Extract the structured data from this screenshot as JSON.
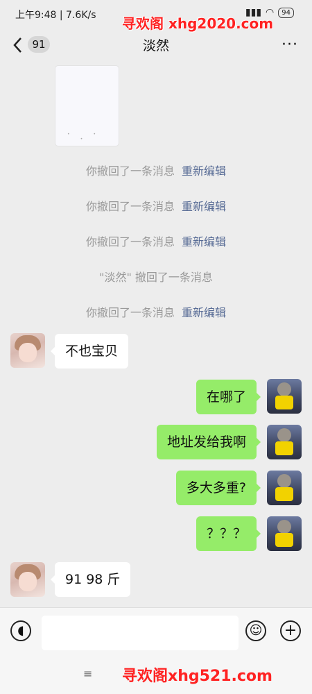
{
  "status_bar": {
    "time": "上午9:48 | 7.6K/s",
    "watermark": "寻欢阁 xhg2020.com",
    "battery": "94"
  },
  "header": {
    "back_count": "91",
    "title": "淡然",
    "more": "···"
  },
  "system_messages": [
    {
      "text": "你撤回了一条消息",
      "action": "重新编辑"
    },
    {
      "text": "你撤回了一条消息",
      "action": "重新编辑"
    },
    {
      "text": "你撤回了一条消息",
      "action": "重新编辑"
    },
    {
      "text": "\"淡然\" 撤回了一条消息",
      "action": ""
    },
    {
      "text": "你撤回了一条消息",
      "action": "重新编辑"
    }
  ],
  "messages": [
    {
      "side": "left",
      "text": "不也宝贝"
    },
    {
      "side": "right",
      "text": "在哪了"
    },
    {
      "side": "right",
      "text": "地址发给我啊"
    },
    {
      "side": "right",
      "text": "多大多重?"
    },
    {
      "side": "right",
      "text": "？？？"
    },
    {
      "side": "left",
      "text": "91  98 斤"
    }
  ],
  "bottom": {
    "menu_icon": "≡",
    "watermark": "寻欢阁xhg521.com"
  },
  "colors": {
    "self_bubble": "#95ec69",
    "other_bubble": "#ffffff",
    "link": "#576b95",
    "watermark": "#ff2222"
  }
}
